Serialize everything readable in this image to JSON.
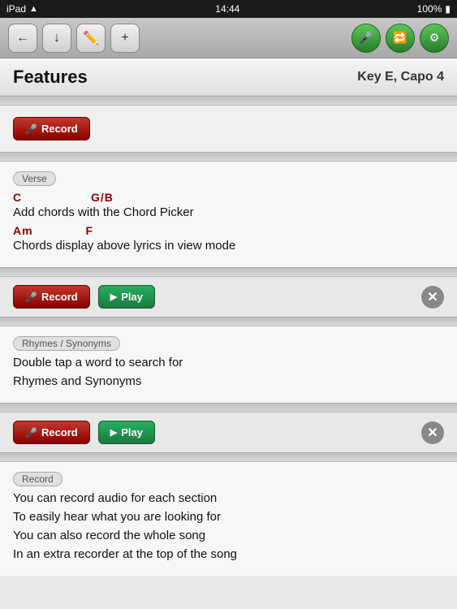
{
  "status_bar": {
    "carrier": "iPad",
    "time": "14:44",
    "battery": "100%"
  },
  "toolbar": {
    "back_label": "←",
    "down_label": "↓",
    "edit_label": "✏",
    "add_label": "+",
    "mic_label": "🎤",
    "loop_label": "🔁",
    "settings_label": "⚙"
  },
  "header": {
    "title": "Features",
    "key_info": "Key E, Capo 4"
  },
  "sections": {
    "record_top": {
      "btn_label": "Record",
      "mic_char": "🎤"
    },
    "verse": {
      "tag": "Verse",
      "chord_line1": {
        "c": "C",
        "g_b": "G/B"
      },
      "lyric1": "Add chords with the Chord Picker",
      "chord_line2": {
        "am": "Am",
        "f": "F"
      },
      "lyric2": "Chords display above lyrics in view mode"
    },
    "controls1": {
      "record_label": "Record",
      "play_label": "Play",
      "mic_char": "🎤",
      "play_char": "▶"
    },
    "rhymes": {
      "tag": "Rhymes / Synonyms",
      "line1": "Double tap a word to search for",
      "line2": "Rhymes and Synonyms"
    },
    "controls2": {
      "record_label": "Record",
      "play_label": "Play",
      "mic_char": "🎤",
      "play_char": "▶"
    },
    "record_section": {
      "tag": "Record",
      "line1": "You can record audio for each section",
      "line2": "To easily hear what you are looking for",
      "line3": "You can also record the whole song",
      "line4": "In an extra recorder at the top of the song"
    }
  }
}
